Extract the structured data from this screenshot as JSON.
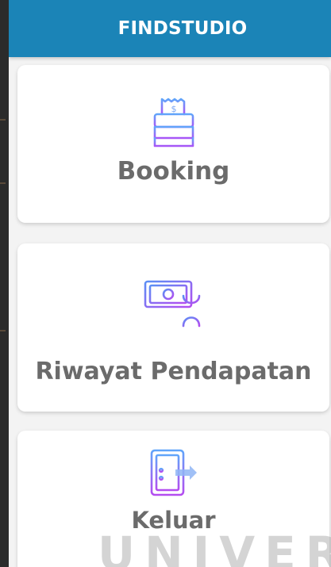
{
  "app": {
    "title": "FINDSTUDIO"
  },
  "menu": [
    {
      "id": "booking",
      "label": "Booking",
      "icon": "cash-register-icon"
    },
    {
      "id": "riwayat",
      "label": "Riwayat Pendapatan",
      "icon": "money-hourglass-icon"
    },
    {
      "id": "keluar",
      "label": "Keluar",
      "icon": "exit-door-icon"
    }
  ],
  "watermark": "UNIVERS",
  "colors": {
    "appbar": "#1b84b7",
    "icon_gradient_start": "#7c3aed",
    "icon_gradient_end": "#60a5fa",
    "label": "#6b6b6b"
  }
}
